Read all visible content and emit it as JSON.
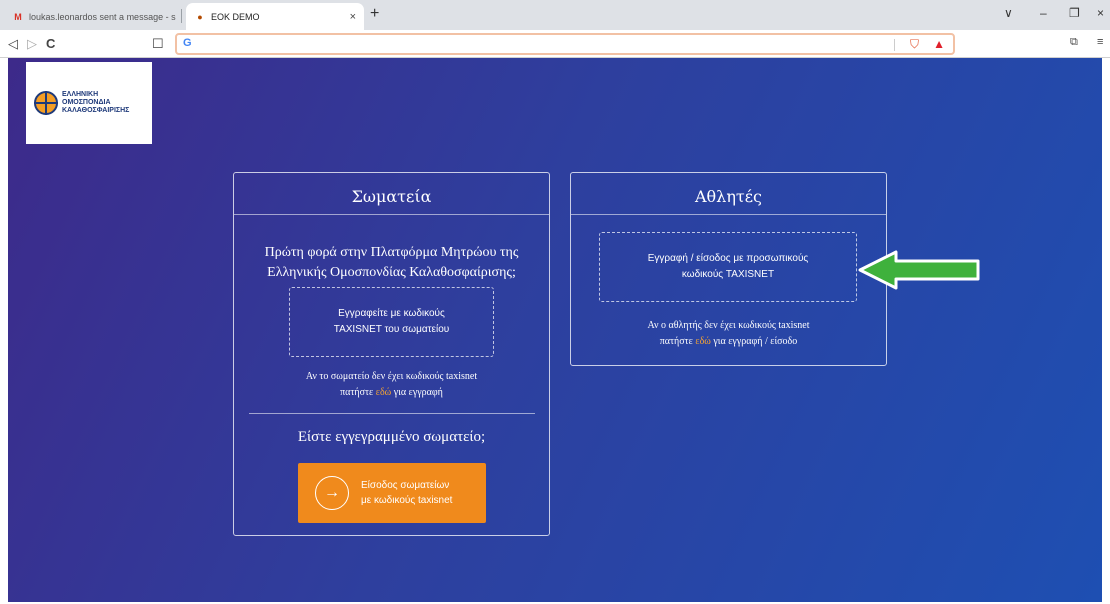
{
  "browser": {
    "tabs": [
      {
        "title": "loukas.leonardos sent a message - sar",
        "active": false
      },
      {
        "title": "ΕΟΚ DEMO",
        "active": true
      }
    ],
    "close_glyph": "×",
    "new_tab_glyph": "+",
    "address": {
      "value": "",
      "g_icon": "G"
    },
    "window_controls": {
      "dropdown": "∨",
      "minimize": "–",
      "restore": "❐",
      "close": "×"
    },
    "nav": {
      "back": "◁",
      "forward": "▷",
      "reload": "C",
      "bookmark": "☐"
    },
    "ext_icons": [
      "brave-shield-icon",
      "brave-rewards-icon"
    ],
    "right_icons": {
      "wallet": "⧉",
      "menu": "≡"
    }
  },
  "logo": {
    "lines": [
      "ΕΛΛΗΝΙΚΗ",
      "ΟΜΟΣΠΟΝΔΙΑ",
      "ΚΑΛΑΘΟΣΦΑΙΡΙΣΗΣ"
    ]
  },
  "clubs": {
    "title": "Σωματεία",
    "intro": "Πρώτη φορά στην Πλατφόρμα Μητρώου της Ελληνικής Ομοσπονδίας Καλαθοσφαίρισης;",
    "register_line1": "Εγγραφείτε με κωδικούς",
    "register_line2": "TAXISNET του σωματείου",
    "note_line1": "Αν το σωματείο δεν έχει κωδικούς taxisnet",
    "note_pre": "πατήστε ",
    "note_link": "εδώ",
    "note_post": " για εγγραφή",
    "registered_question": "Είστε εγγεγραμμένο σωματείο;",
    "login_line1": "Είσοδος σωματείων",
    "login_line2": "με κωδικούς taxisnet",
    "login_icon": "→"
  },
  "athletes": {
    "title": "Αθλητές",
    "register_line1": "Εγγραφή / είσοδος με προσωπικούς",
    "register_line2": "κωδικούς TAXISNET",
    "note_line1": "Αν ο αθλητής δεν έχει κωδικούς taxisnet",
    "note_pre": "πατήστε ",
    "note_link": "εδώ",
    "note_post": " για εγγραφή / είσοδο"
  },
  "colors": {
    "accent": "#f08a1c",
    "link": "#f7a532",
    "arrow": "#3fb13c"
  }
}
